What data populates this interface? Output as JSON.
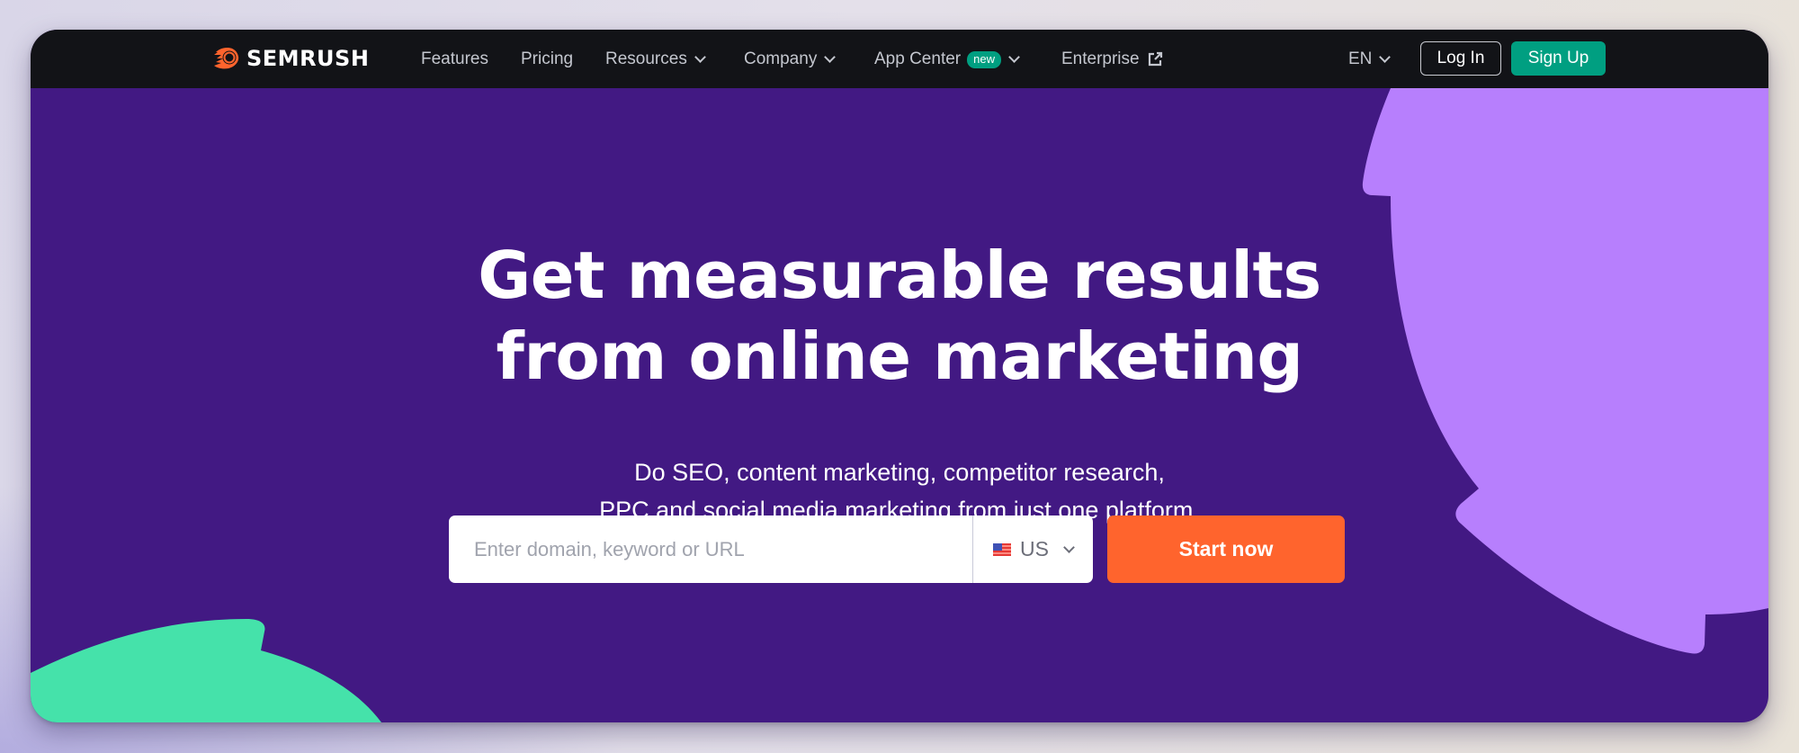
{
  "nav": {
    "brand": "SEMRUSH",
    "items": [
      {
        "label": "Features",
        "has_dropdown": false
      },
      {
        "label": "Pricing",
        "has_dropdown": false
      },
      {
        "label": "Resources",
        "has_dropdown": true
      },
      {
        "label": "Company",
        "has_dropdown": true
      },
      {
        "label": "App Center",
        "has_dropdown": true,
        "badge": "new"
      },
      {
        "label": "Enterprise",
        "external": true
      }
    ],
    "language": "EN",
    "login_label": "Log In",
    "signup_label": "Sign Up"
  },
  "hero": {
    "headline_line1": "Get measurable results",
    "headline_line2": "from online marketing",
    "sub_line1": "Do SEO, content marketing, competitor research,",
    "sub_line2": "PPC and social media marketing from just one platform.",
    "search": {
      "placeholder": "Enter domain, keyword or URL",
      "value": "",
      "database": "US",
      "database_icon": "us-flag-icon"
    },
    "cta_label": "Start now"
  },
  "colors": {
    "nav_bg": "#121317",
    "hero_bg": "#421983",
    "accent_green": "#009f81",
    "cta_orange": "#ff642d",
    "blob_purple": "#b77ffd",
    "blob_green": "#45e2aa"
  }
}
